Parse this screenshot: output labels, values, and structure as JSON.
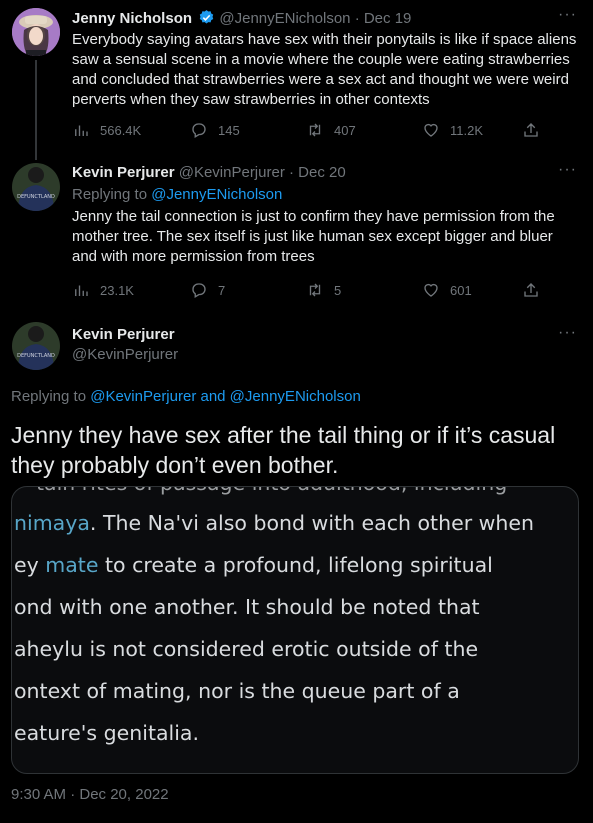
{
  "tweets": [
    {
      "name": "Jenny Nicholson",
      "verified": true,
      "handle": "@JennyENicholson",
      "date": "· Dec 19",
      "text": [
        "Everybody saying avatars have sex with their ponytails is like if space aliens",
        "saw a sensual scene in a movie where the couple were eating strawberries",
        "and concluded that strawberries were a sex act and thought we were weird",
        "perverts when they saw strawberries in other contexts"
      ],
      "views": "566.4K",
      "replies": "145",
      "retweets": "407",
      "likes": "11.2K"
    },
    {
      "name": "Kevin Perjurer",
      "handle": "@KevinPerjurer",
      "date": "· Dec 20",
      "replying_prefix": "Replying to ",
      "replying_to": "@JennyENicholson",
      "text": [
        "Jenny the tail connection is just to confirm they have permission from the",
        "mother tree. The sex itself is just like human sex except bigger and bluer",
        "and with more permission from trees"
      ],
      "views": "23.1K",
      "replies": "7",
      "retweets": "5",
      "likes": "601"
    }
  ],
  "main_tweet": {
    "name": "Kevin Perjurer",
    "handle": "@KevinPerjurer",
    "replying_prefix": "Replying to ",
    "replying_to": "@KevinPerjurer and @JennyENicholson",
    "text": [
      "Jenny they have sex after the tail thing or if it’s casual",
      "they probably don’t even bother."
    ],
    "image_text": {
      "line0": "tain rites of passage into adulthood, including",
      "line1_link": "nimaya",
      "line1_rest": ". The Na'vi also bond with each other when",
      "line2_pre": "ey ",
      "line2_link": "mate",
      "line2_rest": " to create a profound, lifelong spiritual",
      "line3": "ond with one another. It should be noted that",
      "line4": "aheylu is not considered erotic outside of the",
      "line5": "ontext of mating, nor is the queue part of a",
      "line6": "eature's genitalia."
    },
    "timestamp": "9:30 AM · Dec 20, 2022"
  },
  "colors": {
    "link": "#1d9bf0",
    "muted": "#71767b",
    "image_link": "#58a6c8"
  }
}
